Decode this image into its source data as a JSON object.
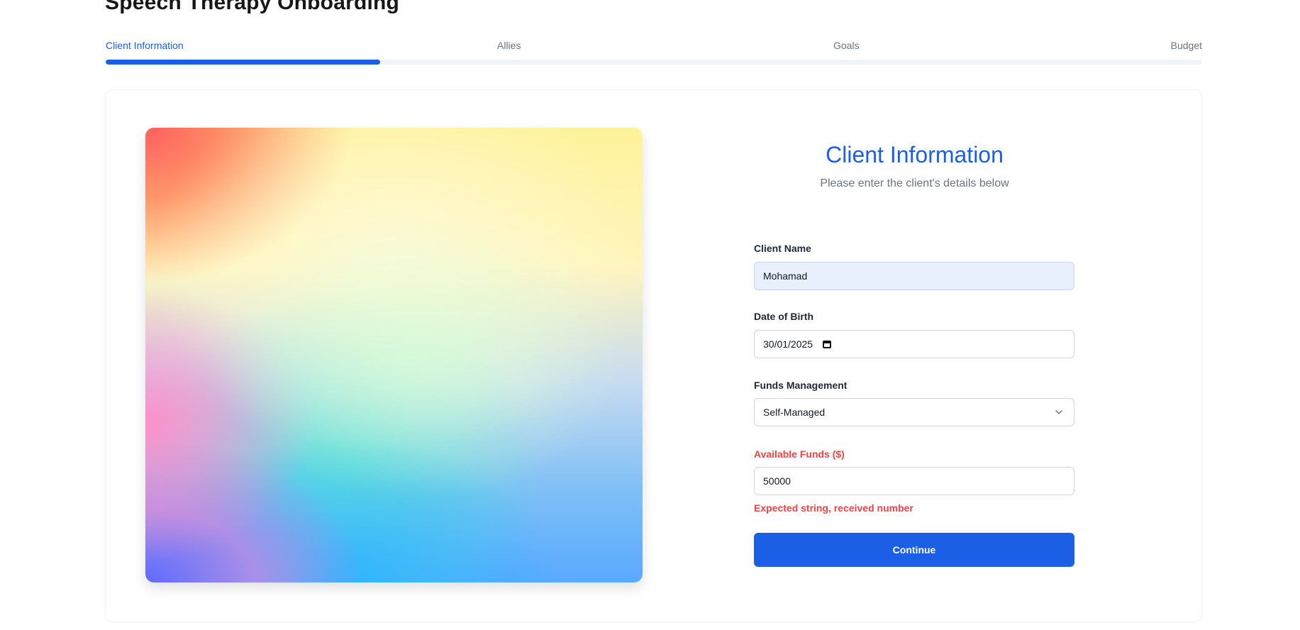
{
  "header": {
    "title": "Speech Therapy Onboarding"
  },
  "steps": [
    {
      "label": "Client Information",
      "active": true
    },
    {
      "label": "Allies",
      "active": false
    },
    {
      "label": "Goals",
      "active": false
    },
    {
      "label": "Budget",
      "active": false
    }
  ],
  "progress": {
    "fraction": 0.25,
    "color": "#1a5fe5"
  },
  "form": {
    "title": "Client Information",
    "subtitle": "Please enter the client's details below",
    "client_name": {
      "label": "Client Name",
      "value": "Mohamad"
    },
    "date_of_birth": {
      "label": "Date of Birth",
      "value": "30/01/2025",
      "icon": "calendar-icon"
    },
    "funds_management": {
      "label": "Funds Management",
      "value": "Self-Managed",
      "icon": "chevron-down-icon"
    },
    "available_funds": {
      "label": "Available Funds ($)",
      "value": "50000",
      "error": "Expected string, received number"
    },
    "continue_label": "Continue"
  },
  "colors": {
    "accent": "#1a5fe5",
    "error": "#ef4444"
  }
}
